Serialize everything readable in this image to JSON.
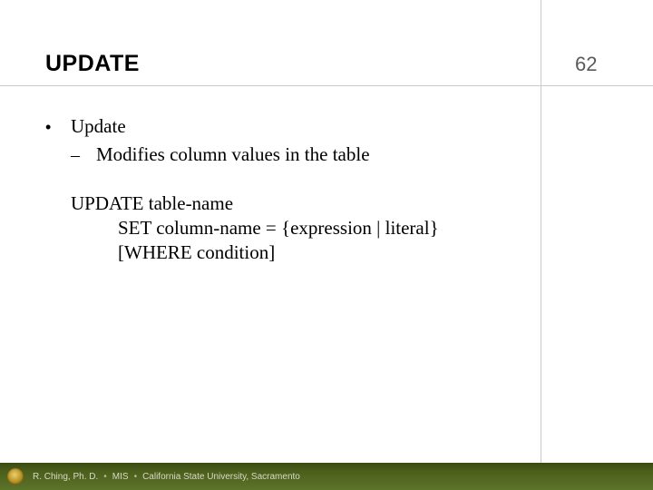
{
  "title": "UPDATE",
  "page_number": "62",
  "content": {
    "bullet": "Update",
    "sub": "Modifies column values in the table",
    "code_line1": "UPDATE table-name",
    "code_line2": "SET column-name = {expression | literal}",
    "code_line3": "[WHERE condition]"
  },
  "footer": {
    "author": "R. Ching, Ph. D.",
    "dept": "MIS",
    "institution": "California State University, Sacramento"
  }
}
